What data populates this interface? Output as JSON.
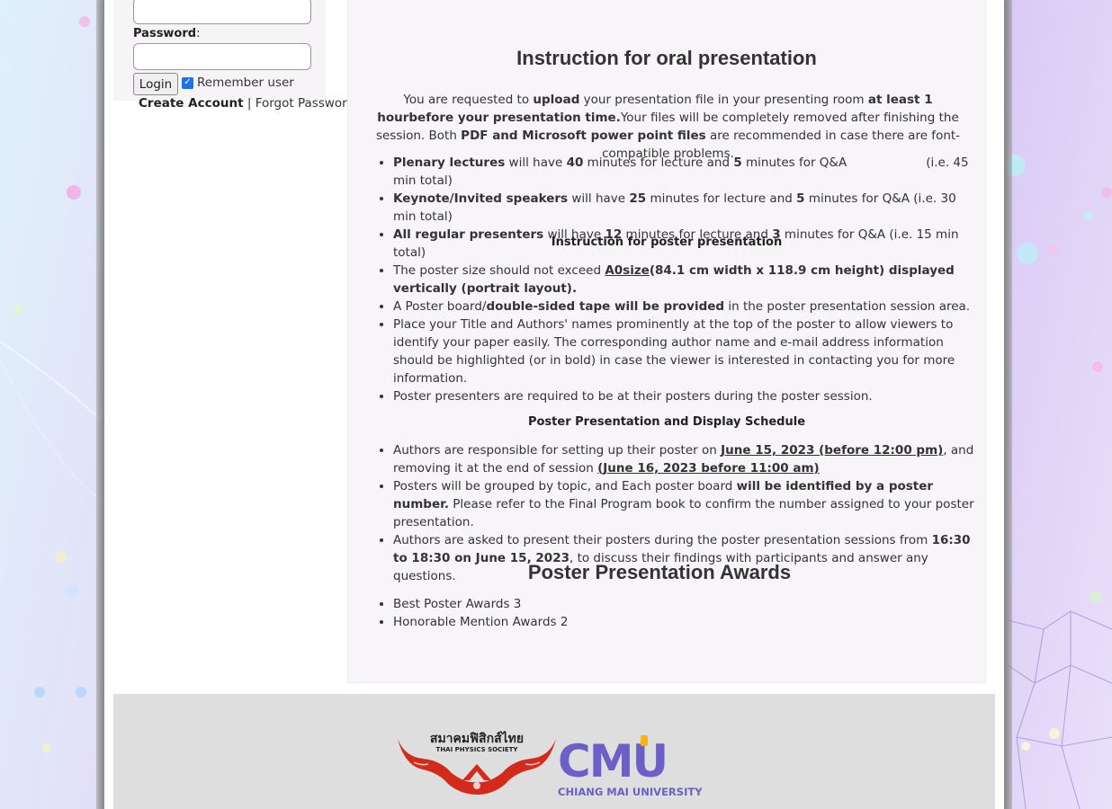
{
  "login": {
    "username_value": "",
    "password_label": "Password",
    "password_value": "",
    "login_button": "Login",
    "remember_label": "Remember user",
    "remember_checked": true,
    "create_account": "Create Account",
    "separator": "|",
    "forgot_password": "Forgot Password"
  },
  "oral": {
    "title": "Instruction for oral presentation",
    "intro": {
      "t1": "You are requested to ",
      "b1": "upload",
      "t2": " your presentation file in your presenting room ",
      "b2": "at least 1 hourbefore your presentation time.",
      "t3": "Your files will be completely removed after finishing the session. Both ",
      "b3": "PDF and Microsoft power point files",
      "t4": " are recommended in case there are font-compatible problems."
    },
    "items": [
      {
        "b1": "Plenary lectures",
        "t1": " will have ",
        "b2": "40",
        "t2": " minutes for lecture and ",
        "b3": "5",
        "t3": " minutes for Q&A",
        "t4": "(i.e. 45 min total)"
      },
      {
        "b1": "Keynote/Invited speakers",
        "t1": " will have ",
        "b2": "25",
        "t2": " minutes for lecture and ",
        "b3": "5",
        "t3": " minutes for Q&A (i.e. 30 min total)"
      },
      {
        "b1": "All regular presenters",
        "t1": " will have ",
        "b2": "12",
        "t2": " minutes for lecture and ",
        "b3": "3",
        "t3": " minutes for Q&A (i.e. 15 min total)"
      }
    ]
  },
  "poster": {
    "title": "Instruction for poster presentation",
    "item1": {
      "t1": "The poster size should not exceed ",
      "u1": "A0size",
      "b1": "(84.1 cm width x 118.9 cm height) displayed vertically (portrait layout)."
    },
    "item2": {
      "t1": "A Poster board/",
      "b1": "double-sided tape will be provided",
      "t2": " in the poster presentation session area."
    },
    "item3": "Place your Title and Authors' names prominently at the top of the poster to allow viewers to identify your paper easily. The corresponding author name and e-mail address information should be highlighted (or in bold) in case the viewer is interested in contacting you for more information.",
    "item4": "Poster presenters are required to be at their posters during the poster session."
  },
  "schedule": {
    "title": "Poster Presentation and Display Schedule",
    "item1": {
      "t1": "Authors are responsible for setting up their poster on ",
      "u1": "June 15, 2023 (before 12:00 pm)",
      "t2": ", and removing it at the end of session ",
      "u2": "(June 16, 2023 before 11:00 am)"
    },
    "item2": {
      "t1": "Posters will be grouped by topic, and Each poster board ",
      "b1": "will be identified by a poster number.",
      "t2": " Please refer to the Final Program book to confirm the number assigned to your poster presentation."
    },
    "item3": {
      "t1": "Authors are asked to present their posters during the poster presentation sessions from ",
      "b1": "16:30 to 18:30 on June 15, 2023",
      "t2": ", to discuss their findings with participants and answer any questions."
    }
  },
  "awards": {
    "title": "Poster Presentation Awards",
    "items": [
      "Best Poster Awards 3",
      "Honorable Mention Awards 2"
    ]
  },
  "footer": {
    "tps_thai": "สมาคมฟิสิกส์ไทย",
    "tps_en": "THAI PHYSICS SOCIETY",
    "cmu_logo": "CMU",
    "cmu_name": "CHIANG MAI UNIVERSITY"
  },
  "colors": {
    "tps_red": "#d42a1c",
    "cmu_purple": "#6c5fc7",
    "cmu_yellow": "#f4b21b"
  }
}
